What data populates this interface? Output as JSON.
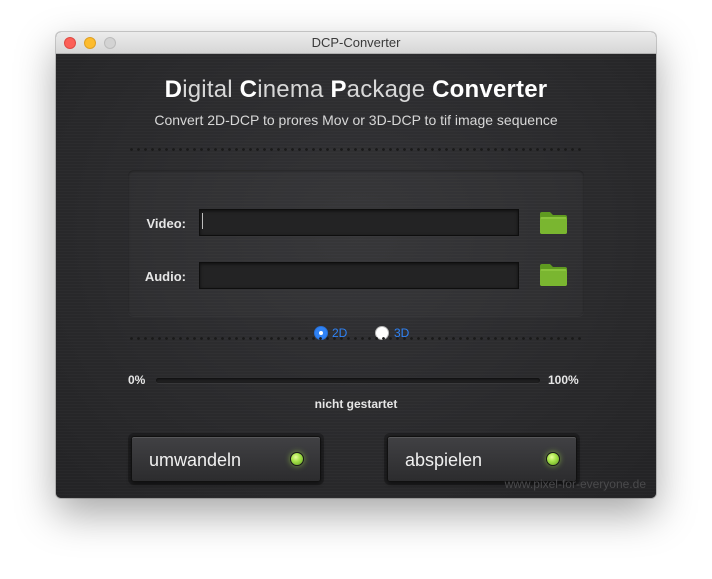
{
  "window": {
    "title": "DCP-Converter"
  },
  "heading": {
    "parts": [
      "D",
      "igital ",
      "C",
      "inema ",
      "P",
      "ackage ",
      "Converter"
    ]
  },
  "subtitle": "Convert 2D-DCP to prores Mov or 3D-DCP to tif image sequence",
  "form": {
    "video_label": "Video:",
    "video_value": "",
    "audio_label": "Audio:",
    "audio_value": ""
  },
  "icons": {
    "folder_video": "folder-icon",
    "folder_audio": "folder-icon",
    "folder_color": "#7ab630"
  },
  "mode": {
    "options": [
      "2D",
      "3D"
    ],
    "selected": "2D"
  },
  "progress": {
    "min_label": "0%",
    "max_label": "100%",
    "value": 0,
    "status": "nicht gestartet"
  },
  "buttons": {
    "convert_label": "umwandeln",
    "play_label": "abspielen",
    "led_color": "#a6e34a"
  },
  "watermark": "www.pixel-for-everyone.de"
}
